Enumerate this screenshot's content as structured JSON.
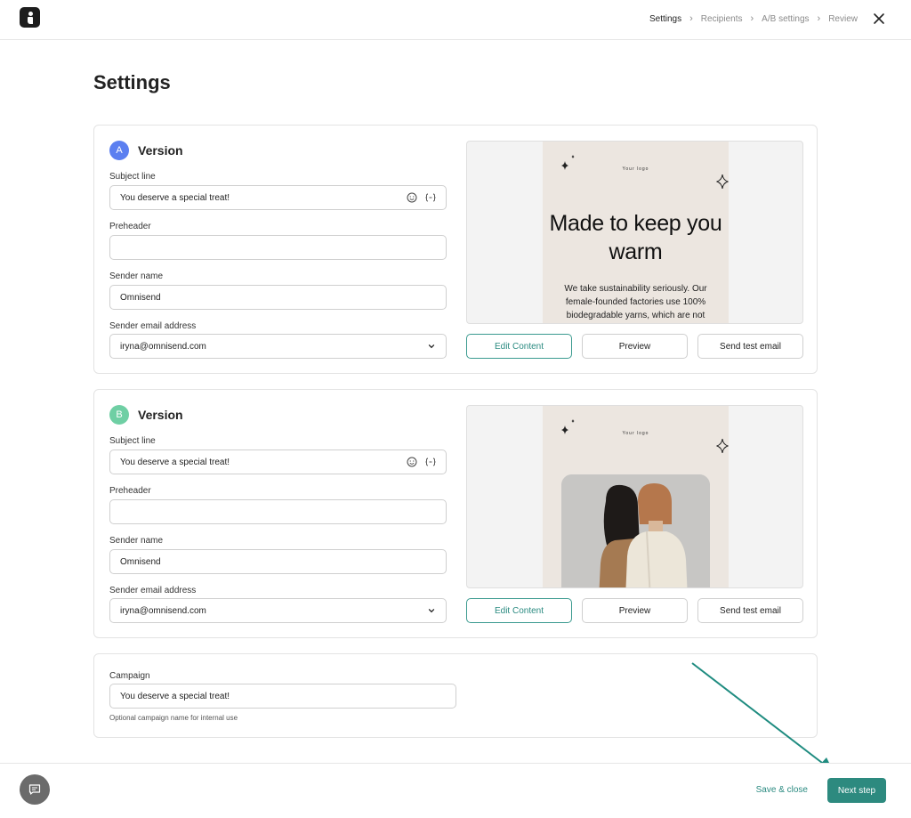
{
  "header": {
    "breadcrumbs": [
      {
        "label": "Settings",
        "active": true
      },
      {
        "label": "Recipients",
        "active": false
      },
      {
        "label": "A/B settings",
        "active": false
      },
      {
        "label": "Review",
        "active": false
      }
    ]
  },
  "page": {
    "title": "Settings"
  },
  "versions": [
    {
      "badge": "A",
      "title": "Version",
      "subject_label": "Subject line",
      "subject_value": "You deserve a special treat!",
      "preheader_label": "Preheader",
      "preheader_value": "",
      "sender_name_label": "Sender name",
      "sender_name_value": "Omnisend",
      "sender_email_label": "Sender email address",
      "sender_email_value": "iryna@omnisend.com",
      "preview": {
        "logo_text": "Your logo",
        "headline": "Made to keep you warm",
        "body": "We take sustainability seriously. Our female-founded factories use 100% biodegradable yarns, which are not"
      },
      "buttons": {
        "edit": "Edit Content",
        "preview": "Preview",
        "test": "Send test email"
      }
    },
    {
      "badge": "B",
      "title": "Version",
      "subject_label": "Subject line",
      "subject_value": "You deserve a special treat!",
      "preheader_label": "Preheader",
      "preheader_value": "",
      "sender_name_label": "Sender name",
      "sender_name_value": "Omnisend",
      "sender_email_label": "Sender email address",
      "sender_email_value": "iryna@omnisend.com",
      "preview": {
        "logo_text": "Your logo"
      },
      "buttons": {
        "edit": "Edit Content",
        "preview": "Preview",
        "test": "Send test email"
      }
    }
  ],
  "campaign": {
    "label": "Campaign",
    "value": "You deserve a special treat!",
    "hint": "Optional campaign name for internal use"
  },
  "footer": {
    "save_close": "Save & close",
    "next": "Next step"
  },
  "colors": {
    "accent": "#2d8a7f",
    "badge_a": "#5b7ff0",
    "badge_b": "#6fcfa4"
  }
}
